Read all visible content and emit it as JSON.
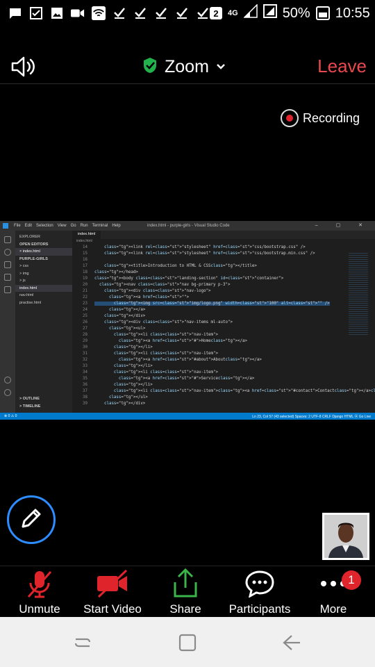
{
  "status_bar": {
    "notification_icons": [
      "message-icon",
      "check-square-icon",
      "image-icon",
      "video-icon",
      "wifi-hotspot-icon",
      "check-icon",
      "check-icon",
      "check-icon",
      "check-icon",
      "check-icon"
    ],
    "sim_badge": "2",
    "network_type": "4G",
    "battery_percent": "50%",
    "time": "10:55"
  },
  "meeting_header": {
    "title": "Zoom",
    "leave_label": "Leave",
    "shield_color": "#22b24c",
    "leave_color": "#e8484e"
  },
  "recording": {
    "label": "Recording"
  },
  "shared_screen": {
    "window_title": "index.html - purple-girls - Visual Studio Code",
    "menu": [
      "File",
      "Edit",
      "Selection",
      "View",
      "Go",
      "Run",
      "Terminal",
      "Help"
    ],
    "sidebar": {
      "header": "EXPLORER",
      "open_editors": "OPEN EDITORS",
      "open_file": "× index.html",
      "project": "PURPLE-GIRLS",
      "folders": [
        "> css",
        "> img",
        "> js"
      ],
      "files": [
        "index.html",
        "nav.html",
        "practise.html"
      ],
      "outline": "> OUTLINE",
      "timeline": "> TIMELINE"
    },
    "tab_label": "index.html",
    "breadcrumb": "index.html",
    "code_lines": [
      {
        "n": "14",
        "t": "    <link rel=\"stylesheet\" href=\"css/bootstrap.css\" />"
      },
      {
        "n": "15",
        "t": "    <link rel=\"stylesheet\" href=\"css/bootstrap.min.css\" />"
      },
      {
        "n": "16",
        "t": ""
      },
      {
        "n": "17",
        "t": "    <title>Introduction to HTML & CSS</title>"
      },
      {
        "n": "18",
        "t": "</head>"
      },
      {
        "n": "19",
        "t": "<body class=\"landing-section\" id=\"container\">"
      },
      {
        "n": "20",
        "t": "  <nav class=\"nav bg-primary p-3\">"
      },
      {
        "n": "21",
        "t": "    <div class=\"nav-logo\">"
      },
      {
        "n": "22",
        "t": "      <a href=\"\">"
      },
      {
        "n": "23",
        "t": "        <img src=\"img/logo.png\" width=\"100\" alt=\"\" />"
      },
      {
        "n": "24",
        "t": "      </a>"
      },
      {
        "n": "25",
        "t": "    </div>"
      },
      {
        "n": "26",
        "t": "    <div class=\"nav-items ml-auto\">"
      },
      {
        "n": "27",
        "t": "      <ul>"
      },
      {
        "n": "28",
        "t": "        <li class=\"nav-item\">"
      },
      {
        "n": "29",
        "t": "          <a href=\"#\">Home</a>"
      },
      {
        "n": "30",
        "t": "        </li>"
      },
      {
        "n": "31",
        "t": "        <li class=\"nav-item\">"
      },
      {
        "n": "32",
        "t": "          <a href=\"#about\">About</a>"
      },
      {
        "n": "33",
        "t": "        </li>"
      },
      {
        "n": "34",
        "t": "        <li class=\"nav-item\">"
      },
      {
        "n": "35",
        "t": "          <a href=\"#\">Service</a>"
      },
      {
        "n": "36",
        "t": "        </li>"
      },
      {
        "n": "37",
        "t": "        <li class=\"nav-item\"><a href=\"#contact\">Contact</a></li>"
      },
      {
        "n": "38",
        "t": "      </ul>"
      },
      {
        "n": "39",
        "t": "    </div>"
      }
    ],
    "status_left": "⊗ 0 ⚠ 0",
    "status_right": "Ln 23, Col 57 (43 selected)   Spaces: 2   UTF-8   CRLF   Django HTML   ⦿ Go Live"
  },
  "toolbar": {
    "unmute_label": "Unmute",
    "start_video_label": "Start Video",
    "share_label": "Share",
    "participants_label": "Participants",
    "more_label": "More",
    "more_badge": "1",
    "muted_color": "#e0242c",
    "share_color": "#3bb54a"
  },
  "android_nav": {
    "buttons": [
      "recent-apps",
      "home",
      "back"
    ]
  }
}
